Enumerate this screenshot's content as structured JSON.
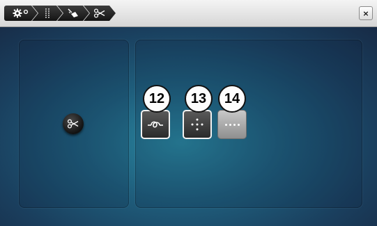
{
  "header": {
    "breadcrumbs": [
      {
        "icon": "settings-icon"
      },
      {
        "icon": "stitch-line-icon"
      },
      {
        "icon": "sewing-foot-icon"
      },
      {
        "icon": "scissors-icon"
      }
    ],
    "close_label": "×"
  },
  "main": {
    "left_panel": {
      "cutter_button": {
        "icon": "scissors-icon"
      }
    },
    "right_panel": {
      "buttons": [
        {
          "badge": "12",
          "icon": "thread-knot-icon",
          "state": "active"
        },
        {
          "badge": "13",
          "icon": "dot-cross-icon",
          "state": "active"
        },
        {
          "badge": "14",
          "icon": "dotted-line-icon",
          "state": "inactive"
        }
      ]
    }
  },
  "colors": {
    "topbar": "#e4e4e4",
    "background_center": "#2a87a0",
    "background_edge": "#172b46",
    "badge_fill": "#fdfdfd",
    "active_border": "#f2f2f2"
  }
}
